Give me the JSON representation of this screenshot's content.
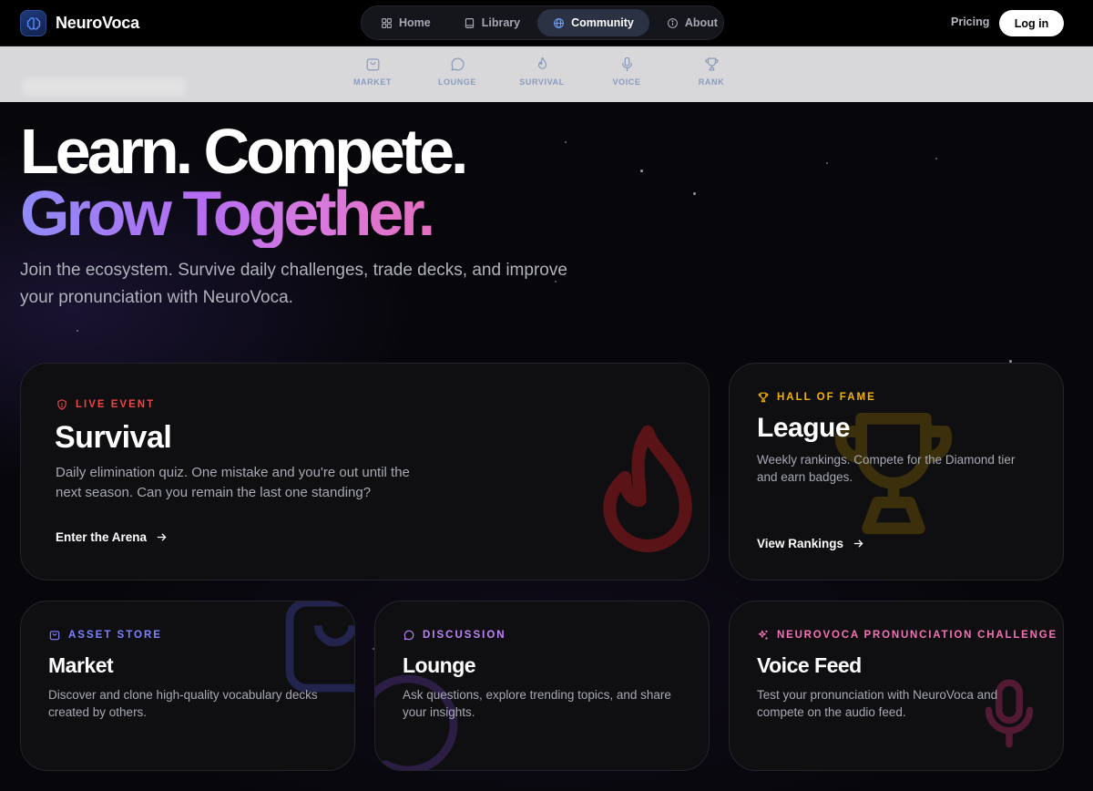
{
  "brand": {
    "name": "NeuroVoca"
  },
  "topnav": {
    "items": [
      {
        "label": "Home",
        "icon": "grid-icon"
      },
      {
        "label": "Library",
        "icon": "book-icon"
      },
      {
        "label": "Community",
        "icon": "globe-icon",
        "active": true
      },
      {
        "label": "About",
        "icon": "info-icon"
      }
    ],
    "pricing": "Pricing",
    "login": "Log in"
  },
  "subnav": {
    "items": [
      {
        "label": "MARKET",
        "icon": "shopping-bag-icon"
      },
      {
        "label": "LOUNGE",
        "icon": "chat-bubble-icon"
      },
      {
        "label": "SURVIVAL",
        "icon": "flame-icon"
      },
      {
        "label": "VOICE",
        "icon": "microphone-icon"
      },
      {
        "label": "RANK",
        "icon": "trophy-icon"
      }
    ]
  },
  "hero": {
    "line1": "Learn. Compete.",
    "line2": "Grow Together.",
    "subtitle": "Join the ecosystem. Survive daily challenges, trade decks, and improve your pronunciation with NeuroVoca."
  },
  "cards": {
    "survival": {
      "tag": "LIVE EVENT",
      "title": "Survival",
      "description": "Daily elimination quiz. One mistake and you're out until the next season. Can you remain the last one standing?",
      "cta": "Enter the Arena",
      "accent": "#ef4444"
    },
    "league": {
      "tag": "HALL OF FAME",
      "title": "League",
      "description": "Weekly rankings. Compete for the Diamond tier and earn badges.",
      "cta": "View Rankings",
      "accent": "#f5b301"
    },
    "market": {
      "tag": "ASSET STORE",
      "title": "Market",
      "description": "Discover and clone high-quality vocabulary decks created by others.",
      "accent": "#7c83ff"
    },
    "lounge": {
      "tag": "DISCUSSION",
      "title": "Lounge",
      "description": "Ask questions, explore trending topics, and share your insights.",
      "accent": "#c084fc"
    },
    "voice": {
      "tag": "NEUROVOCA PRONUNCIATION CHALLENGE",
      "title": "Voice Feed",
      "description": "Test your pronunciation with NeuroVoca and compete on the audio feed.",
      "accent": "#f472b6"
    }
  }
}
